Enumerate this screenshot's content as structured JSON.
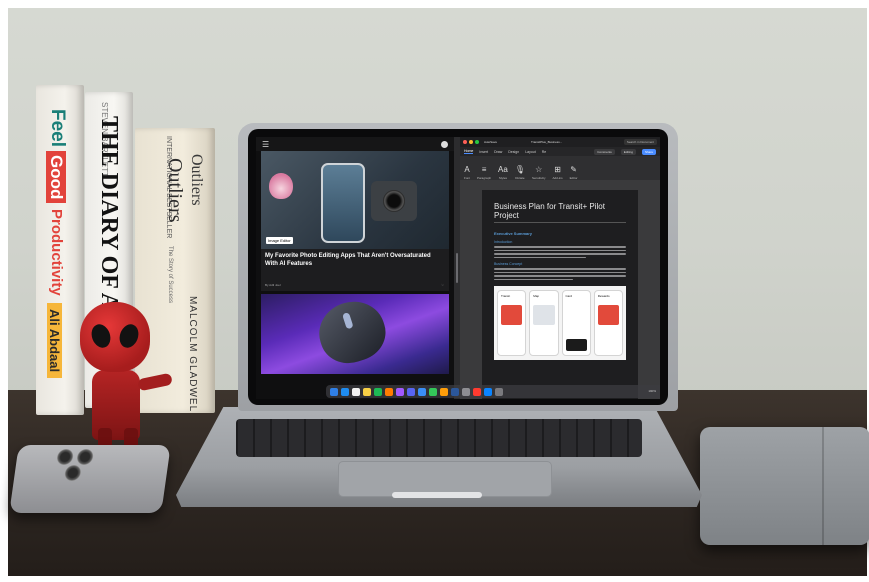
{
  "books": [
    {
      "title_part1": "Feel",
      "title_part2": "Good",
      "title_part3": "Productivity",
      "author": "Ali Abdaal"
    },
    {
      "author": "STEVEN BARTLETT",
      "title": "THE DIARY OF A C"
    },
    {
      "top_label": "INTERNATIONAL BESTSELLER",
      "title": "Outliers",
      "tagline": "The Story of Success",
      "title2": "Outliers",
      "author": "MALCOLM GLADWELL"
    }
  ],
  "laptop_screen": {
    "left_app": {
      "menu_icon": "hamburger-icon",
      "account_icon": "account-icon",
      "image_label": "Image Editor",
      "article_title": "My Favorite Photo Editing Apps That Aren't Oversaturated With AI Features",
      "article_meta": "By Adil Joel",
      "article_action": "♡"
    },
    "word_app": {
      "app_name": "AutoSave",
      "doc_name": "TransitPlus_Business...",
      "search_placeholder": "Search in Document",
      "tabs": [
        "Home",
        "Insert",
        "Draw",
        "Design",
        "Layout",
        "Re"
      ],
      "buttons": {
        "comments": "Comments",
        "editing": "Editing",
        "share": "Share"
      },
      "tools": [
        {
          "icon": "A",
          "label": "Font"
        },
        {
          "icon": "≡",
          "label": "Paragraph"
        },
        {
          "icon": "Aa",
          "label": "Styles"
        },
        {
          "icon": "🎙",
          "label": "Dictate"
        },
        {
          "icon": "☆",
          "label": "Sensitivity"
        },
        {
          "icon": "⊞",
          "label": "Add-ins"
        },
        {
          "icon": "✎",
          "label": "Editor"
        }
      ],
      "document": {
        "title": "Business Plan for Transit+ Pilot Project",
        "section": "Executive Summary",
        "subsection1": "Introduction",
        "subsection2": "Business Concept",
        "app_screens": [
          "Transit",
          "Map",
          "Card",
          "Rewards"
        ]
      },
      "zoom": "190%"
    },
    "dock_icons": [
      "finder-icon",
      "safari-icon",
      "notion-icon",
      "notes-icon",
      "spotify-icon",
      "illustrator-icon",
      "figma-icon",
      "discord-icon",
      "mail-icon",
      "messages-icon",
      "photos-icon",
      "word-icon",
      "settings-icon",
      "calendar-icon",
      "appstore-icon",
      "trash-icon"
    ],
    "accent_colors": {
      "ms_blue": "#4a8cff",
      "heading_blue": "#5a9bd5",
      "dot_red": "#ff5f57",
      "dot_yellow": "#febc2e",
      "dot_green": "#28c840"
    }
  }
}
